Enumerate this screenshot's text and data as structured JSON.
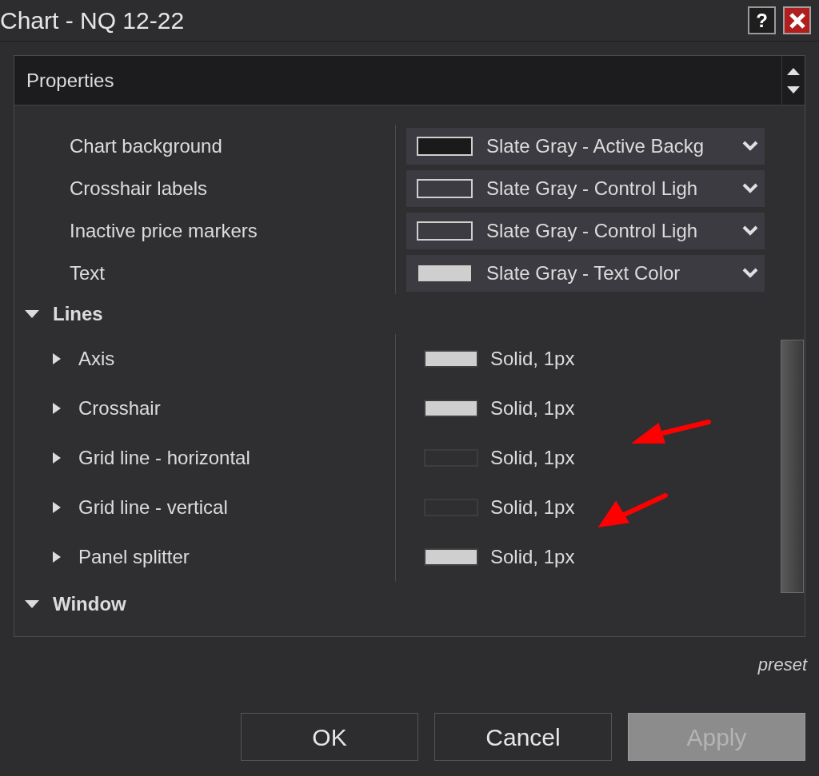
{
  "window": {
    "title": "Chart - NQ 12-22",
    "help_button": "?"
  },
  "panel": {
    "title": "Properties"
  },
  "items": [
    {
      "kind": "color",
      "label": "Chart background",
      "value": "Slate Gray - Active Backg",
      "swatch": {
        "kind": "dark"
      }
    },
    {
      "kind": "color",
      "label": "Crosshair labels",
      "value": "Slate Gray - Control Ligh",
      "swatch": {
        "kind": "outline"
      }
    },
    {
      "kind": "color",
      "label": "Inactive price markers",
      "value": "Slate Gray - Control Ligh",
      "swatch": {
        "kind": "outline"
      }
    },
    {
      "kind": "color",
      "label": "Text",
      "value": "Slate Gray - Text Color",
      "swatch": {
        "kind": "light"
      }
    },
    {
      "kind": "group",
      "label": "Lines",
      "expanded": true,
      "children": [
        {
          "label": "Axis",
          "expanded": false,
          "value": "Solid, 1px",
          "swatch": {
            "kind": "light"
          }
        },
        {
          "label": "Crosshair",
          "expanded": false,
          "value": "Solid, 1px",
          "swatch": {
            "kind": "light"
          }
        },
        {
          "label": "Grid line - horizontal",
          "expanded": false,
          "value": "Solid, 1px",
          "swatch": {
            "kind": "faint"
          }
        },
        {
          "label": "Grid line - vertical",
          "expanded": false,
          "value": "Solid, 1px",
          "swatch": {
            "kind": "faint"
          }
        },
        {
          "label": "Panel splitter",
          "expanded": false,
          "value": "Solid, 1px",
          "swatch": {
            "kind": "light"
          }
        }
      ]
    },
    {
      "kind": "group",
      "label": "Window",
      "expanded": true
    }
  ],
  "preset_label": "preset",
  "buttons": [
    {
      "label": "OK",
      "disabled": false
    },
    {
      "label": "Cancel",
      "disabled": false
    },
    {
      "label": "Apply",
      "disabled": true
    }
  ],
  "annotations": [
    {
      "kind": "arrow"
    },
    {
      "kind": "arrow"
    }
  ]
}
